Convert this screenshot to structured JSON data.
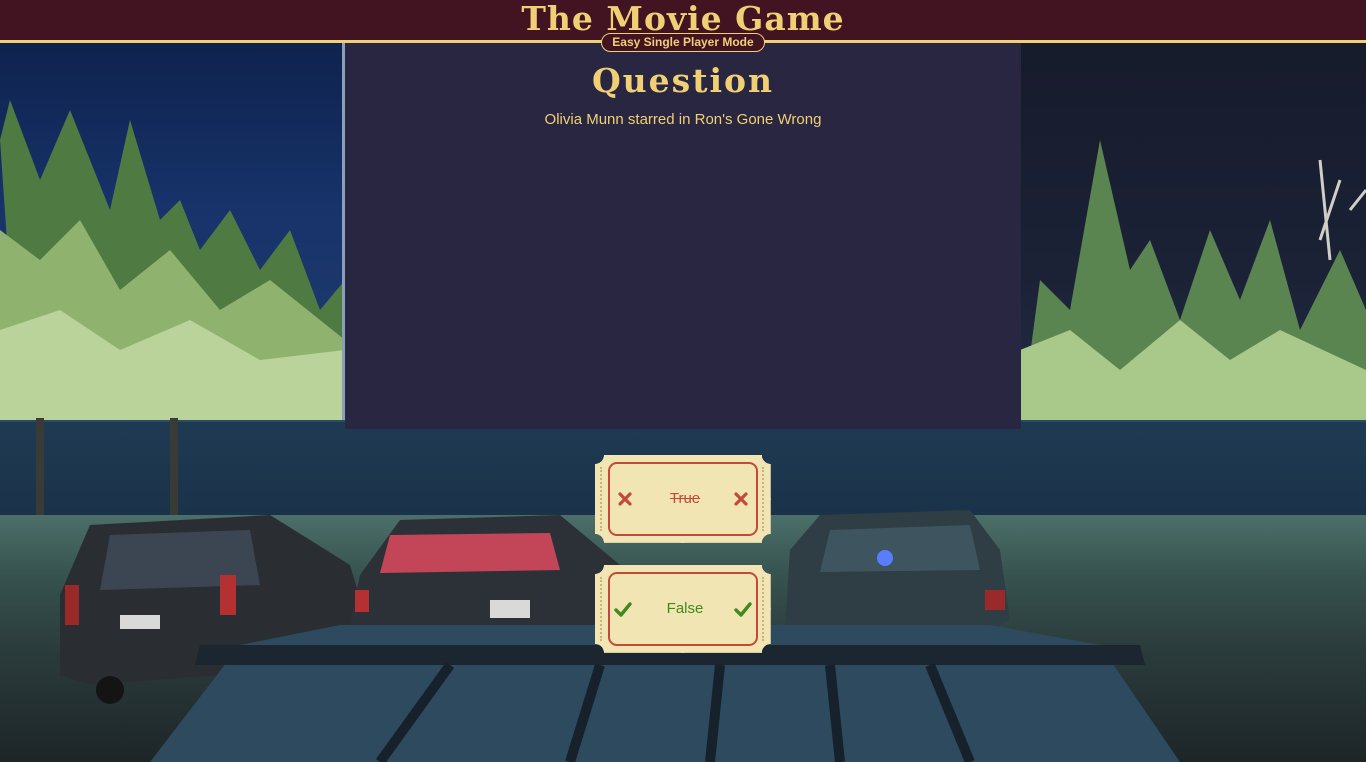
{
  "header": {
    "title": "The Movie Game",
    "mode": "Easy Single Player Mode"
  },
  "question": {
    "heading": "Question",
    "text": "Olivia Munn starred in Ron's Gone Wrong"
  },
  "answers": [
    {
      "label": "True",
      "state": "incorrect",
      "icon": "x-mark-icon",
      "color": "#c24a3a"
    },
    {
      "label": "False",
      "state": "correct",
      "icon": "check-icon",
      "color": "#3f8a1f"
    }
  ],
  "theme": {
    "header_bg": "#421422",
    "accent_gold": "#f1cf74",
    "screen_bg": "#282640",
    "ticket_bg": "#f1e5b3"
  }
}
